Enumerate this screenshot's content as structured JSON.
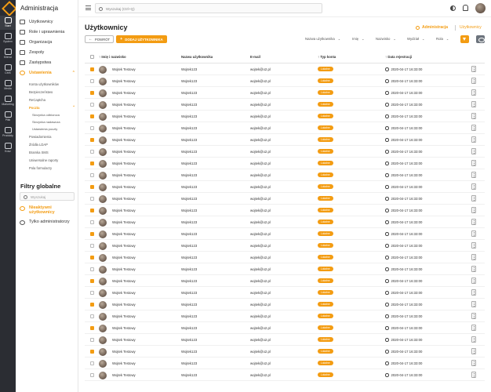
{
  "rail": {
    "items": [
      {
        "label": "Start",
        "icon": "home-icon"
      },
      {
        "label": "System",
        "icon": "monitor-icon"
      },
      {
        "label": "Klienci",
        "icon": "users-icon"
      },
      {
        "label": "CMS",
        "icon": "layers-icon"
      },
      {
        "label": "Media",
        "icon": "image-icon"
      },
      {
        "label": "Marketing",
        "icon": "target-icon"
      },
      {
        "label": "Pliki",
        "icon": "folder-icon"
      },
      {
        "label": "Produkty",
        "icon": "box-icon"
      },
      {
        "label": "Kosz",
        "icon": "trash-icon"
      }
    ]
  },
  "sidebar": {
    "title": "Administracja",
    "menu": [
      {
        "label": "Użytkownicy"
      },
      {
        "label": "Role i uprawnienia"
      },
      {
        "label": "Organizacja"
      },
      {
        "label": "Zespoły"
      },
      {
        "label": "Zastępstwa"
      },
      {
        "label": "Ustawienia",
        "active": true
      }
    ],
    "settings_sub": [
      {
        "label": "Konta użytkowników"
      },
      {
        "label": "Bezpieczeństwo"
      },
      {
        "label": "ReCaptcha"
      },
      {
        "label": "Poczta",
        "active": true
      }
    ],
    "poczta_sub": [
      {
        "label": "Skrzynka odbiorcza"
      },
      {
        "label": "Skrzynka nadawcza"
      },
      {
        "label": "Ustawienia poczty"
      }
    ],
    "settings_sub2": [
      {
        "label": "Powiadomienia"
      },
      {
        "label": "Źródła LDAP"
      },
      {
        "label": "Bramka SMS"
      },
      {
        "label": "Uniwersalne raporty"
      },
      {
        "label": "Pola formularzy"
      }
    ],
    "filters_title": "Filtry globalne",
    "filter_search_placeholder": "Wyszukaj",
    "filters": [
      {
        "label": "Nieaktywni użytkownicy",
        "active": true
      },
      {
        "label": "Tylko administratorzy",
        "active": false
      }
    ]
  },
  "topbar": {
    "search_placeholder": "Wyszukaj (Ctrl+Q)"
  },
  "page": {
    "title": "Użytkownicy",
    "link_admin": "Administracja",
    "link_users": "Użytkownicy",
    "back_label": "POWRÓT",
    "add_label": "DODAJ UŻYTKOWNIKA",
    "sorters": [
      {
        "label": "Nazwa użytkownika"
      },
      {
        "label": "Imię"
      },
      {
        "label": "Nazwisko"
      },
      {
        "label": "Wydział"
      },
      {
        "label": "Rola"
      }
    ]
  },
  "table": {
    "columns": [
      "Imię i nazwisko",
      "Nazwa użytkownika",
      "E-mail",
      "Typ konta",
      "Data rejestracji"
    ],
    "rows": [
      {
        "checked": true,
        "name": "Wojtek Testowy",
        "login": "Wojtek123",
        "email": "wojtek@o2.pl",
        "type": "Lokalne",
        "date": "2020-04-17 16:33:00"
      },
      {
        "checked": false,
        "name": "Wojtek Testowy",
        "login": "Wojtek123",
        "email": "wojtek@o2.pl",
        "type": "Lokalne",
        "date": "2020-04-17 16:33:00"
      },
      {
        "checked": true,
        "name": "Wojtek Testowy",
        "login": "Wojtek123",
        "email": "wojtek@o2.pl",
        "type": "Lokalne",
        "date": "2020-04-17 16:33:00"
      },
      {
        "checked": false,
        "name": "Wojtek Testowy",
        "login": "Wojtek123",
        "email": "wojtek@o2.pl",
        "type": "Lokalne",
        "date": "2020-04-17 16:33:00"
      },
      {
        "checked": true,
        "name": "Wojtek Testowy",
        "login": "Wojtek123",
        "email": "wojtek@o2.pl",
        "type": "Lokalne",
        "date": "2020-04-17 16:33:00"
      },
      {
        "checked": false,
        "name": "Wojtek Testowy",
        "login": "Wojtek123",
        "email": "wojtek@o2.pl",
        "type": "Lokalne",
        "date": "2020-04-17 16:33:00"
      },
      {
        "checked": true,
        "name": "Wojtek Testowy",
        "login": "Wojtek123",
        "email": "wojtek@o2.pl",
        "type": "Lokalne",
        "date": "2020-04-17 16:33:00"
      },
      {
        "checked": false,
        "name": "Wojtek Testowy",
        "login": "Wojtek123",
        "email": "wojtek@o2.pl",
        "type": "Lokalne",
        "date": "2020-04-17 16:33:00"
      },
      {
        "checked": true,
        "name": "Wojtek Testowy",
        "login": "Wojtek123",
        "email": "wojtek@o2.pl",
        "type": "Lokalne",
        "date": "2020-04-17 16:33:00"
      },
      {
        "checked": false,
        "name": "Wojtek Testowy",
        "login": "Wojtek123",
        "email": "wojtek@o2.pl",
        "type": "Lokalne",
        "date": "2020-04-17 16:33:00"
      },
      {
        "checked": true,
        "name": "Wojtek Testowy",
        "login": "Wojtek123",
        "email": "wojtek@o2.pl",
        "type": "Lokalne",
        "date": "2020-04-17 16:33:00"
      },
      {
        "checked": false,
        "name": "Wojtek Testowy",
        "login": "Wojtek123",
        "email": "wojtek@o2.pl",
        "type": "Lokalne",
        "date": "2020-04-17 16:33:00"
      },
      {
        "checked": true,
        "name": "Wojtek Testowy",
        "login": "Wojtek123",
        "email": "wojtek@o2.pl",
        "type": "Lokalne",
        "date": "2020-04-17 16:33:00"
      },
      {
        "checked": false,
        "name": "Wojtek Testowy",
        "login": "Wojtek123",
        "email": "wojtek@o2.pl",
        "type": "Lokalne",
        "date": "2020-04-17 16:33:00"
      },
      {
        "checked": true,
        "name": "Wojtek Testowy",
        "login": "Wojtek123",
        "email": "wojtek@o2.pl",
        "type": "Lokalne",
        "date": "2020-04-17 16:33:00"
      },
      {
        "checked": false,
        "name": "Wojtek Testowy",
        "login": "Wojtek123",
        "email": "wojtek@o2.pl",
        "type": "Lokalne",
        "date": "2020-04-17 16:33:00"
      },
      {
        "checked": true,
        "name": "Wojtek Testowy",
        "login": "Wojtek123",
        "email": "wojtek@o2.pl",
        "type": "Lokalne",
        "date": "2020-04-17 16:33:00"
      },
      {
        "checked": false,
        "name": "Wojtek Testowy",
        "login": "Wojtek123",
        "email": "wojtek@o2.pl",
        "type": "Lokalne",
        "date": "2020-04-17 16:33:00"
      },
      {
        "checked": true,
        "name": "Wojtek Testowy",
        "login": "Wojtek123",
        "email": "wojtek@o2.pl",
        "type": "Lokalne",
        "date": "2020-04-17 16:33:00"
      },
      {
        "checked": false,
        "name": "Wojtek Testowy",
        "login": "Wojtek123",
        "email": "wojtek@o2.pl",
        "type": "Lokalne",
        "date": "2020-04-17 16:33:00"
      },
      {
        "checked": true,
        "name": "Wojtek Testowy",
        "login": "Wojtek123",
        "email": "wojtek@o2.pl",
        "type": "Lokalne",
        "date": "2020-04-17 16:33:00"
      },
      {
        "checked": false,
        "name": "Wojtek Testowy",
        "login": "Wojtek123",
        "email": "wojtek@o2.pl",
        "type": "Lokalne",
        "date": "2020-04-17 16:33:00"
      },
      {
        "checked": true,
        "name": "Wojtek Testowy",
        "login": "Wojtek123",
        "email": "wojtek@o2.pl",
        "type": "Lokalne",
        "date": "2020-04-17 16:33:00"
      },
      {
        "checked": false,
        "name": "Wojtek Testowy",
        "login": "Wojtek123",
        "email": "wojtek@o2.pl",
        "type": "Lokalne",
        "date": "2020-04-17 16:33:00"
      },
      {
        "checked": true,
        "name": "Wojtek Testowy",
        "login": "Wojtek123",
        "email": "wojtek@o2.pl",
        "type": "Lokalne",
        "date": "2020-04-17 16:33:00"
      },
      {
        "checked": false,
        "name": "Wojtek Testowy",
        "login": "Wojtek123",
        "email": "wojtek@o2.pl",
        "type": "Lokalne",
        "date": "2020-04-17 16:33:00"
      },
      {
        "checked": false,
        "name": "Wojtek Testowy",
        "login": "Wojtek123",
        "email": "wojtek@o2.pl",
        "type": "Lokalne",
        "date": "2020-04-17 16:33:00"
      }
    ]
  },
  "colors": {
    "accent": "#f39c12",
    "rail": "#2b2d33"
  }
}
